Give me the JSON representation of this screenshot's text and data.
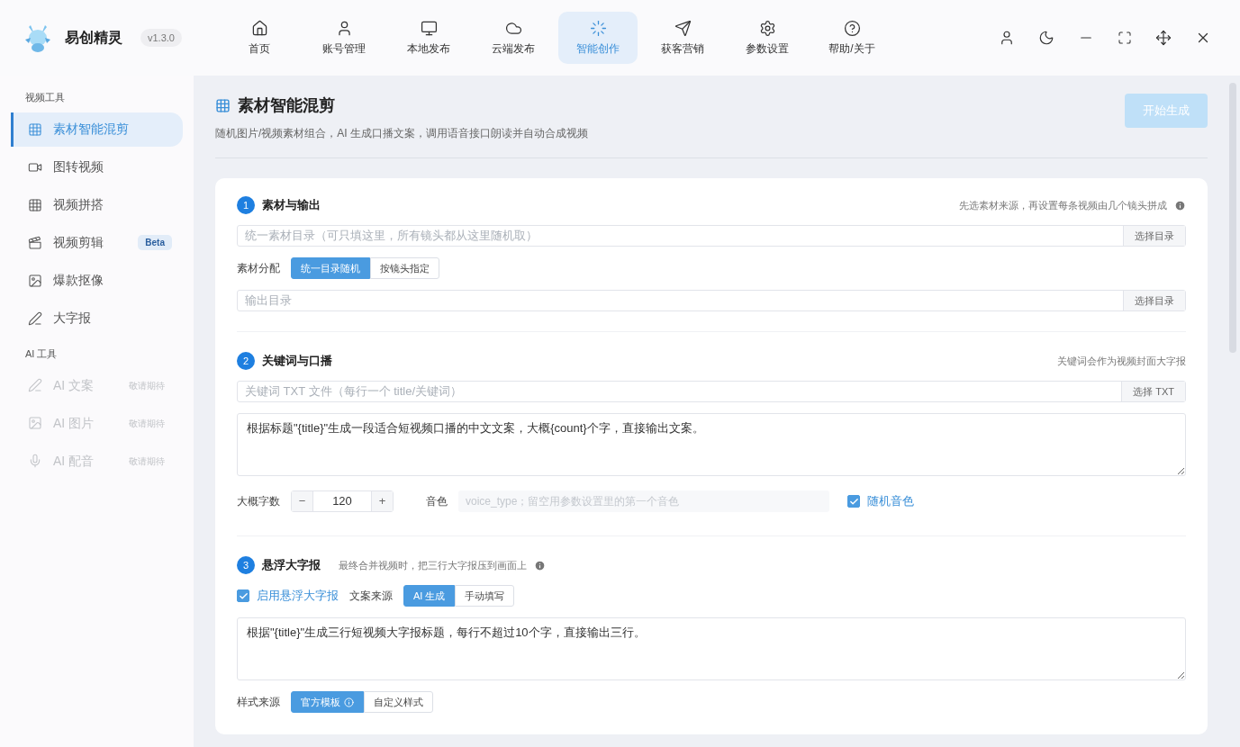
{
  "app": {
    "name": "易创精灵",
    "version": "v1.3.0"
  },
  "nav": [
    {
      "label": "首页",
      "selected": false
    },
    {
      "label": "账号管理",
      "selected": false
    },
    {
      "label": "本地发布",
      "selected": false
    },
    {
      "label": "云端发布",
      "selected": false
    },
    {
      "label": "智能创作",
      "selected": true
    },
    {
      "label": "获客营销",
      "selected": false
    },
    {
      "label": "参数设置",
      "selected": false
    },
    {
      "label": "帮助/关于",
      "selected": false
    }
  ],
  "sidebar": {
    "groups": [
      {
        "title": "视频工具",
        "items": [
          {
            "label": "素材智能混剪",
            "selected": true,
            "disabled": false
          },
          {
            "label": "图转视频",
            "selected": false,
            "disabled": false
          },
          {
            "label": "视频拼搭",
            "selected": false,
            "disabled": false
          },
          {
            "label": "视频剪辑",
            "selected": false,
            "disabled": false,
            "badge": "Beta"
          },
          {
            "label": "爆款抠像",
            "selected": false,
            "disabled": false
          },
          {
            "label": "大字报",
            "selected": false,
            "disabled": false
          }
        ]
      },
      {
        "title": "AI 工具",
        "items": [
          {
            "label": "AI 文案",
            "selected": false,
            "disabled": true,
            "badge": "敬请期待"
          },
          {
            "label": "AI 图片",
            "selected": false,
            "disabled": true,
            "badge": "敬请期待"
          },
          {
            "label": "AI 配音",
            "selected": false,
            "disabled": true,
            "badge": "敬请期待"
          }
        ]
      }
    ]
  },
  "page": {
    "title": "素材智能混剪",
    "subtitle": "随机图片/视频素材组合，AI 生成口播文案，调用语音接口朗读并自动合成视频",
    "action": {
      "label": "开始生成",
      "disabled": true
    }
  },
  "sections": [
    {
      "number": "1",
      "title": "素材与输出",
      "note": "先选素材来源，再设置每条视频由几个镜头拼成",
      "hint_info": true,
      "rows": [
        {
          "kind": "path",
          "placeholder": "统一素材目录（可只填这里，所有镜头都从这里随机取）",
          "button": "选择目录"
        },
        {
          "kind": "segment",
          "label": "素材分配",
          "options": [
            {
              "label": "统一目录随机",
              "selected": true,
              "info": false
            },
            {
              "label": "按镜头指定",
              "selected": false,
              "info": false
            }
          ]
        },
        {
          "kind": "path",
          "placeholder": "输出目录",
          "button": "选择目录"
        }
      ]
    },
    {
      "number": "2",
      "title": "关键词与口播",
      "note": "关键词会作为视频封面大字报",
      "hint_info": false,
      "rows": [
        {
          "kind": "path",
          "placeholder": "关键词 TXT 文件（每行一个 title/关键词）",
          "button": "选择 TXT"
        },
        {
          "kind": "textarea",
          "value": "根据标题\"{title}\"生成一段适合短视频口播的中文文案，大概{count}个字，直接输出文案。"
        },
        {
          "kind": "controls",
          "count_label": "大概字数",
          "minus": "−",
          "count": "120",
          "plus": "+",
          "voice_label": "音色",
          "voice_placeholder": "voice_type；留空用参数设置里的第一个音色",
          "check": {
            "label": "随机音色",
            "checked": true
          }
        }
      ]
    },
    {
      "number": "3",
      "title": "悬浮大字报",
      "caption": "最终合并视频时，把三行大字报压到画面上",
      "hint_info": true,
      "rows": [
        {
          "kind": "check_segment",
          "check": {
            "label": "启用悬浮大字报",
            "checked": true
          },
          "label": "文案来源",
          "options": [
            {
              "label": "AI 生成",
              "selected": true,
              "info": false
            },
            {
              "label": "手动填写",
              "selected": false,
              "info": false
            }
          ]
        },
        {
          "kind": "textarea",
          "value": "根据\"{title}\"生成三行短视频大字报标题，每行不超过10个字，直接输出三行。"
        },
        {
          "kind": "segment",
          "label": "样式来源",
          "options": [
            {
              "label": "官方模板",
              "selected": true,
              "info": true
            },
            {
              "label": "自定义样式",
              "selected": false,
              "info": false
            }
          ]
        }
      ]
    }
  ]
}
